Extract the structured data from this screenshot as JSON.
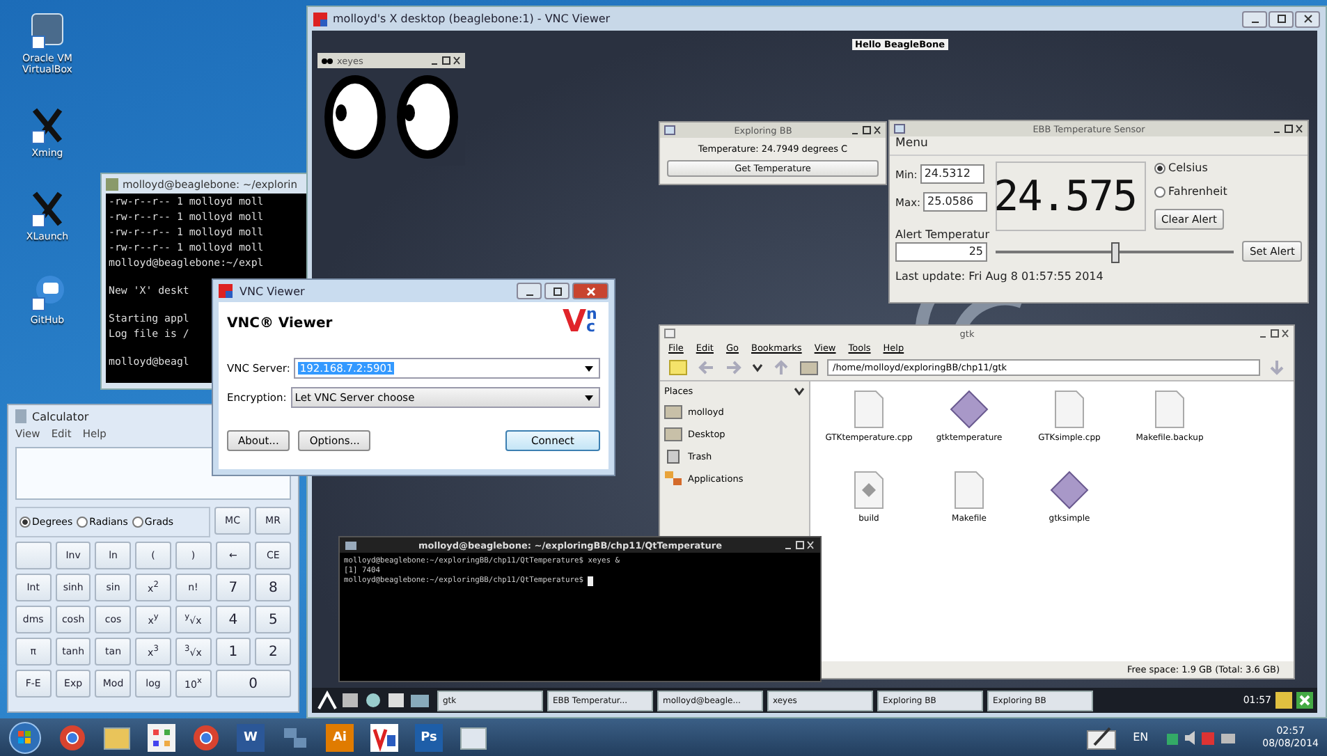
{
  "desktop_icons": [
    {
      "label": "Oracle VM VirtualBox",
      "kind": "box"
    },
    {
      "label": "Xming",
      "kind": "x"
    },
    {
      "label": "XLaunch",
      "kind": "x"
    },
    {
      "label": "GitHub",
      "kind": "github"
    }
  ],
  "putty": {
    "title": "molloyd@beaglebone: ~/explorin",
    "lines": [
      "-rw-r--r-- 1 molloyd moll",
      "-rw-r--r-- 1 molloyd moll",
      "-rw-r--r-- 1 molloyd moll",
      "-rw-r--r-- 1 molloyd moll",
      "molloyd@beaglebone:~/expl",
      "New 'X' deskt",
      "Starting appl",
      "Log file is /",
      "molloyd@beagl"
    ]
  },
  "calculator": {
    "title": "Calculator",
    "menu": [
      "View",
      "Edit",
      "Help"
    ],
    "modes": [
      {
        "label": "Degrees",
        "selected": true
      },
      {
        "label": "Radians",
        "selected": false
      },
      {
        "label": "Grads",
        "selected": false
      }
    ],
    "memory_keys": [
      "MC",
      "MR"
    ],
    "keys": [
      {
        "kind": "blank"
      },
      {
        "kind": "key",
        "label": "Inv"
      },
      {
        "kind": "key",
        "label": "ln"
      },
      {
        "kind": "key",
        "label": "("
      },
      {
        "kind": "key",
        "label": ")"
      },
      {
        "kind": "key",
        "label": "←"
      },
      {
        "kind": "key",
        "label": "CE"
      },
      {
        "kind": "key",
        "label": "Int"
      },
      {
        "kind": "key",
        "label": "sinh"
      },
      {
        "kind": "key",
        "label": "sin"
      },
      {
        "kind": "key",
        "label": "x$^{2}$"
      },
      {
        "kind": "key",
        "label": "n!"
      },
      {
        "kind": "digit",
        "label": "7"
      },
      {
        "kind": "digit",
        "label": "8"
      },
      {
        "kind": "key",
        "label": "dms"
      },
      {
        "kind": "key",
        "label": "cosh"
      },
      {
        "kind": "key",
        "label": "cos"
      },
      {
        "kind": "key",
        "label": "x$^{y}$"
      },
      {
        "kind": "key",
        "label": "$^{y}$√x"
      },
      {
        "kind": "digit",
        "label": "4"
      },
      {
        "kind": "digit",
        "label": "5"
      },
      {
        "kind": "key",
        "label": "π"
      },
      {
        "kind": "key",
        "label": "tanh"
      },
      {
        "kind": "key",
        "label": "tan"
      },
      {
        "kind": "key",
        "label": "x$^{3}$"
      },
      {
        "kind": "key",
        "label": "$^{3}$√x"
      },
      {
        "kind": "digit",
        "label": "1"
      },
      {
        "kind": "digit",
        "label": "2"
      },
      {
        "kind": "key",
        "label": "F-E"
      },
      {
        "kind": "key",
        "label": "Exp"
      },
      {
        "kind": "key",
        "label": "Mod"
      },
      {
        "kind": "key",
        "label": "log"
      },
      {
        "kind": "key",
        "label": "10$^{x}$"
      },
      {
        "kind": "wide",
        "label": "0"
      }
    ]
  },
  "vnc_window": {
    "title": "molloyd's X desktop (beaglebone:1) - VNC Viewer",
    "banner": "Hello BeagleBone",
    "xeyes": {
      "title": "xeyes"
    },
    "exploring_bb": {
      "title": "Exploring BB",
      "reading": "Temperature: 24.7949 degrees C",
      "button": "Get Temperature"
    },
    "ebb_sensor": {
      "title": "EBB Temperature Sensor",
      "menu": "Menu",
      "min_label": "Min:",
      "min": "24.5312",
      "max_label": "Max:",
      "max": "25.0586",
      "display": "24.575",
      "units": [
        {
          "label": "Celsius",
          "selected": true
        },
        {
          "label": "Fahrenheit",
          "selected": false
        }
      ],
      "alert_label": "Alert Temperatur",
      "alert_value": "25",
      "alert_slider": {
        "level": 0.5
      },
      "buttons": [
        "Clear Alert",
        "Set Alert"
      ],
      "last_update": "Last update: Fri Aug 8 01:57:55 2014"
    },
    "file_manager": {
      "title": "gtk",
      "menu": [
        "File",
        "Edit",
        "Go",
        "Bookmarks",
        "View",
        "Tools",
        "Help"
      ],
      "path": "/home/molloyd/exploringBB/chp11/gtk",
      "places_title": "Places",
      "places": [
        {
          "label": "molloyd",
          "kind": "folder"
        },
        {
          "label": "Desktop",
          "kind": "folder"
        },
        {
          "label": "Trash",
          "kind": "trash"
        },
        {
          "label": "Applications",
          "kind": "apps"
        }
      ],
      "files": [
        {
          "name": "GTKtemperature.cpp",
          "kind": "text"
        },
        {
          "name": "gtktemperature",
          "kind": "exec"
        },
        {
          "name": "GTKsimple.cpp",
          "kind": "text"
        },
        {
          "name": "Makefile.backup",
          "kind": "text"
        },
        {
          "name": "build",
          "kind": "script"
        },
        {
          "name": "Makefile",
          "kind": "text"
        },
        {
          "name": "gtksimple",
          "kind": "exec"
        }
      ],
      "status": "Free space: 1.9 GB (Total: 3.6 GB)"
    },
    "terminal": {
      "title": "molloyd@beaglebone: ~/exploringBB/chp11/QtTemperature",
      "lines": [
        "molloyd@beaglebone:~/exploringBB/chp11/QtTemperature$ xeyes &",
        "[1] 7404",
        "molloyd@beaglebone:~/exploringBB/chp11/QtTemperature$ "
      ]
    },
    "taskbar": {
      "tasks": [
        "gtk",
        "EBB Temperatur...",
        "molloyd@beagle...",
        "xeyes",
        "Exploring BB",
        "Exploring BB"
      ],
      "clock": "01:57"
    }
  },
  "vnc_dialog": {
    "title": "VNC Viewer",
    "heading": "VNC® Viewer",
    "logo_big": "V",
    "logo_small": "nc",
    "server_label": "VNC Server:",
    "server": "192.168.7.2:5901",
    "encryption_label": "Encryption:",
    "encryption": "Let VNC Server choose",
    "buttons": [
      "About...",
      "Options...",
      "Connect"
    ]
  },
  "windows_taskbar": {
    "apps": [
      {
        "kind": "chrome"
      },
      {
        "kind": "folder"
      },
      {
        "kind": "grid"
      },
      {
        "kind": "chrome"
      },
      {
        "kind": "word",
        "label": "W"
      },
      {
        "kind": "network"
      },
      {
        "kind": "ai",
        "label": "Ai"
      },
      {
        "kind": "vnc"
      },
      {
        "kind": "ps",
        "label": "Ps"
      },
      {
        "kind": "blank"
      }
    ],
    "language": "EN",
    "time": "02:57",
    "date": "08/08/2014"
  }
}
